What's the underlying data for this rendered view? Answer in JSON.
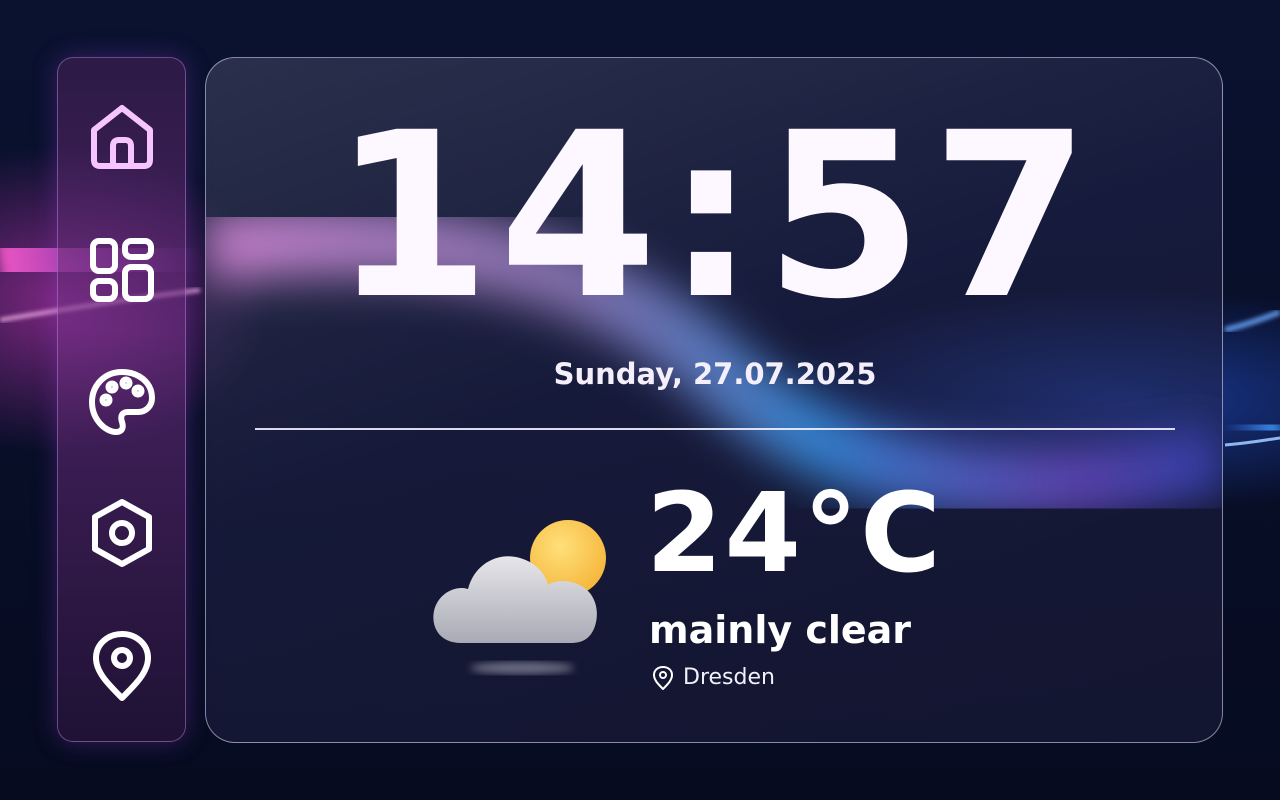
{
  "colors": {
    "accent_pink": "#f6c4ff",
    "icon_white": "#ffffff",
    "text_primary": "#fdf8ff",
    "background": "#070d24"
  },
  "sidebar": {
    "items": [
      {
        "icon": "home-icon",
        "active": true
      },
      {
        "icon": "grid-icon",
        "active": false
      },
      {
        "icon": "palette-icon",
        "active": false
      },
      {
        "icon": "settings-icon",
        "active": false
      },
      {
        "icon": "location-pin-icon",
        "active": false
      }
    ]
  },
  "clock": {
    "time": "14:57",
    "date": "Sunday, 27.07.2025"
  },
  "weather": {
    "icon": "partly-cloudy-icon",
    "temperature": "24°C",
    "condition": "mainly clear",
    "location_icon": "map-pin-icon",
    "location": "Dresden"
  }
}
